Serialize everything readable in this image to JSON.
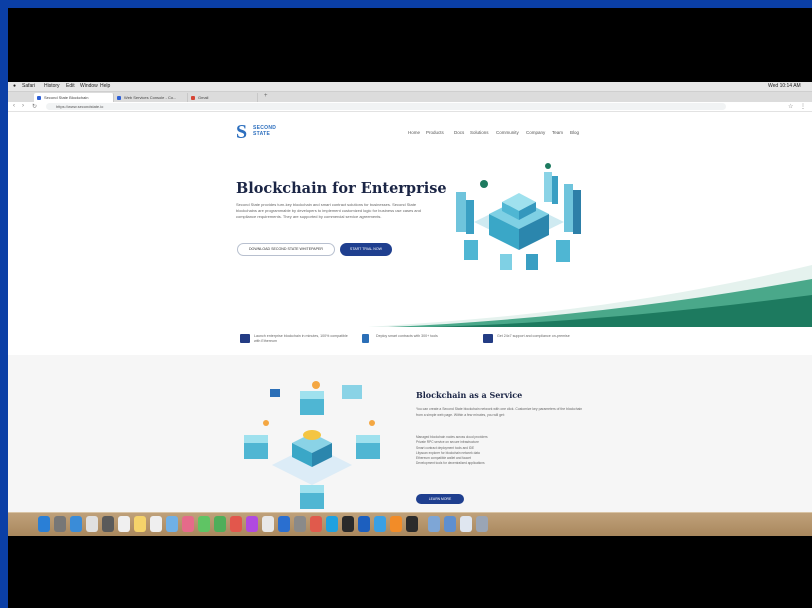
{
  "menubar": {
    "items": [
      "Safari",
      "History",
      "Edit",
      "Window",
      "Help"
    ],
    "right": [
      "Wed 10:14 AM"
    ]
  },
  "browser": {
    "tabs": [
      {
        "label": "Second State Blockchain"
      },
      {
        "label": "Web Services Console - Co..."
      },
      {
        "label": "Gmail"
      }
    ],
    "url": "https://www.secondstate.io"
  },
  "site": {
    "logo_line1": "SECOND",
    "logo_line2": "STATE",
    "nav": [
      "Home",
      "Products",
      "Docs",
      "Solutions",
      "Community",
      "Company",
      "Team",
      "Blog"
    ],
    "hero_title": "Blockchain for Enterprise",
    "hero_desc": "Second State provides turn-key blockchain and smart contract solutions for businesses. Second State blockchains are programmable by developers to implement customized logic for business use cases and compliance requirements. They are supported by commercial service agreements.",
    "btn_outline": "DOWNLOAD SECOND STATE WHITEPAPER",
    "btn_solid": "START TRIAL NOW",
    "features": [
      "Launch enterprise blockchain in minutes, 100% compatible with Ethereum",
      "Deploy smart contracts with 300+ tools",
      "Get 24x7 support and compliance on-premise"
    ],
    "s2_title": "Blockchain as a Service",
    "s2_desc": "You can create a Second State blockchain network with one click. Customize key parameters of the blockchain from a simple web page. Within a few minutes, you will get:",
    "s2_list": [
      "Managed blockchain nodes across cloud providers",
      "Private RPC service on secure infrastructure",
      "Smart contract deployment tools and IDE",
      "Lityscan explorer for blockchain network data",
      "Ethereum compatible wallet and faucet",
      "Development tools for decentralized applications"
    ],
    "s2_btn": "LEARN MORE"
  },
  "colors": {
    "accent": "#1f3f8f",
    "brand": "#2d6fbe",
    "wave_dark": "#1d7a5f",
    "wave_light": "#4aa88a",
    "frame": "#0b3fa6"
  }
}
